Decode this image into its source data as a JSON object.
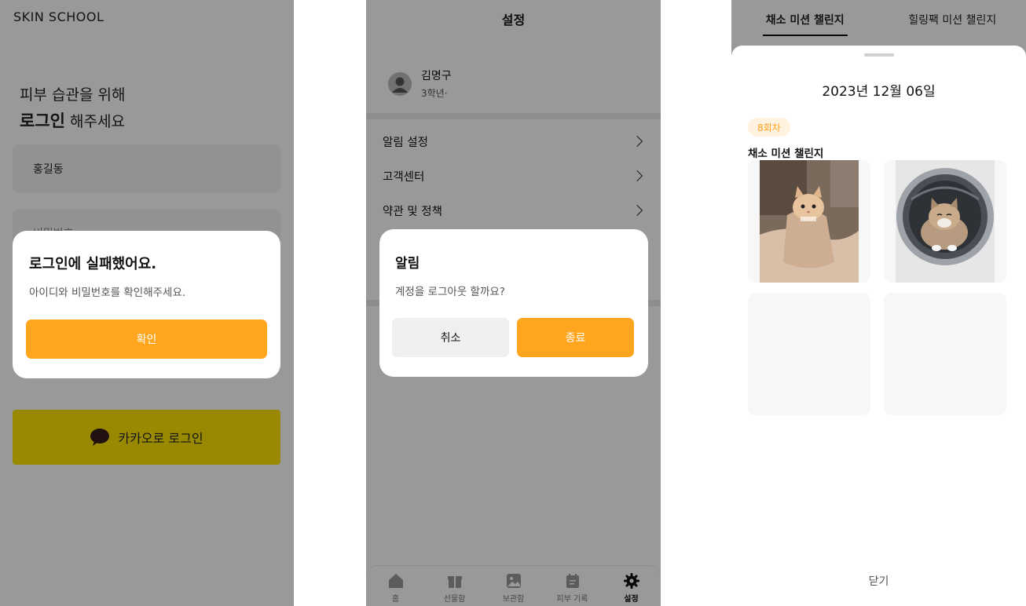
{
  "login": {
    "brand": "SKIN SCHOOL",
    "headline_line1": "피부 습관을 위해",
    "headline_bold": "로그인",
    "headline_rest": " 해주세요",
    "id_value": "홍길동",
    "password_placeholder": "비밀번호",
    "kakao_label": "카카오로 로그인",
    "dialog": {
      "title": "로그인에 실패했어요.",
      "message": "아이디와 비밀번호를 확인해주세요.",
      "confirm_label": "확인"
    }
  },
  "settings": {
    "title": "설정",
    "profile": {
      "name": "김명구",
      "grade": "3학년·"
    },
    "menu": [
      {
        "label": "알림 설정"
      },
      {
        "label": "고객센터"
      },
      {
        "label": "약관 및 정책"
      }
    ],
    "dialog": {
      "title": "알림",
      "message": "계정을 로그아웃 할까요?",
      "cancel_label": "취소",
      "confirm_label": "종료"
    },
    "tabbar": [
      {
        "label": "홈",
        "icon": "home-icon"
      },
      {
        "label": "선물함",
        "icon": "gift-icon"
      },
      {
        "label": "보관함",
        "icon": "gallery-icon"
      },
      {
        "label": "피부 기록",
        "icon": "calendar-icon"
      },
      {
        "label": "설정",
        "icon": "gear-icon",
        "active": true
      }
    ]
  },
  "mission": {
    "tabs": [
      {
        "label": "채소 미션 챌린지",
        "active": true
      },
      {
        "label": "힐링팩 미션 챌린지"
      }
    ],
    "date": "2023년 12월 06일",
    "badge": "8회차",
    "section_title": "채소 미션 챌린지",
    "photos": [
      {
        "subject": "cat-in-blanket"
      },
      {
        "subject": "cat-in-washing-machine"
      },
      {
        "subject": "empty"
      },
      {
        "subject": "empty"
      }
    ],
    "close_label": "닫기"
  },
  "colors": {
    "accent": "#ffa51e",
    "kakao": "#fde500",
    "overlay": "rgba(0,0,0,0.40)"
  }
}
